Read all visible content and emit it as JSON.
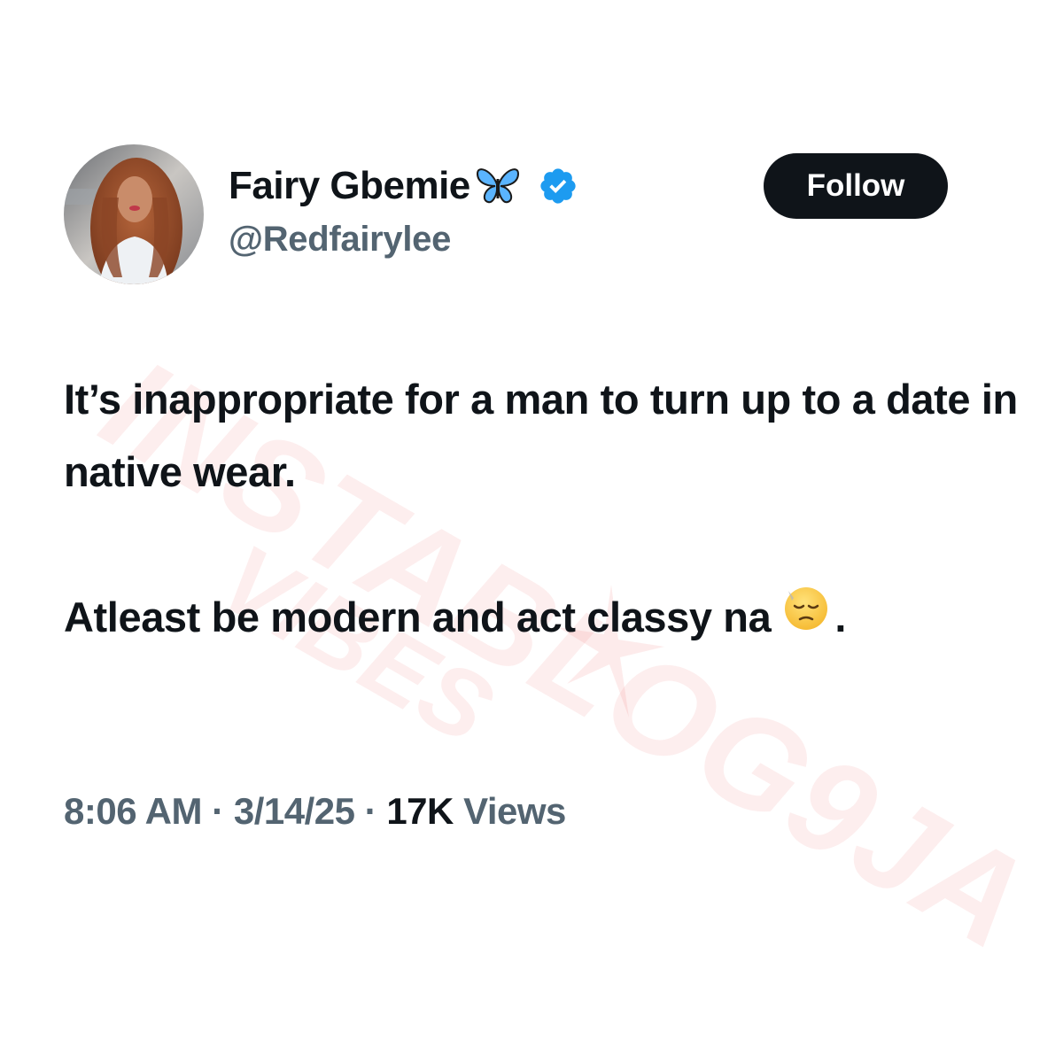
{
  "watermark": {
    "main": "INSTABLOG9JA",
    "sub": "VIBES"
  },
  "tweet": {
    "author": {
      "display_name": "Fairy Gbemie",
      "handle": "@Redfairylee",
      "name_icon": "butterfly-icon",
      "verified_icon": "verified-badge-icon",
      "verified_color": "#1d9bf0"
    },
    "follow_label": "Follow",
    "text": {
      "paragraph1": "It’s inappropriate for a man to turn up to a date in native wear.",
      "paragraph2_start": "Atleast be modern and act classy na",
      "paragraph2_emoji": "pensive-face-emoji",
      "paragraph2_end": "."
    },
    "meta": {
      "time": "8:06 AM",
      "separator": "·",
      "date": "3/14/25",
      "views_count": "17K",
      "views_label": "Views"
    }
  },
  "colors": {
    "text": "#0f1419",
    "muted": "#536471",
    "button_bg": "#0f1419",
    "button_text": "#ffffff",
    "watermark": "#f05a5a"
  }
}
